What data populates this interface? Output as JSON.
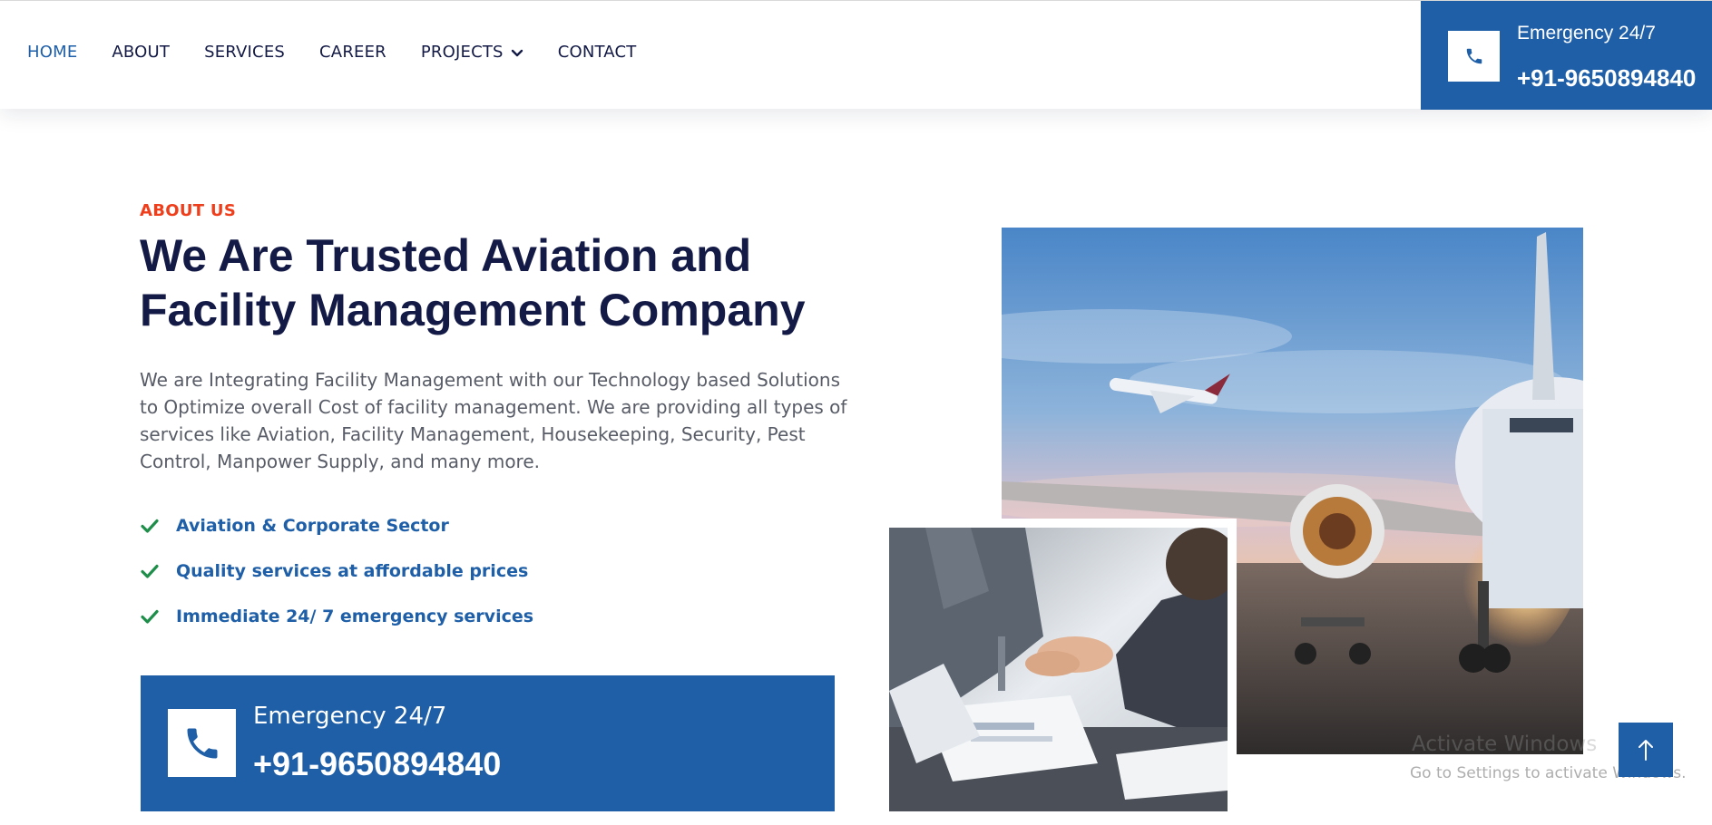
{
  "nav": {
    "items": [
      {
        "label": "HOME",
        "active": true
      },
      {
        "label": "ABOUT"
      },
      {
        "label": "SERVICES"
      },
      {
        "label": "CAREER"
      },
      {
        "label": "PROJECTS",
        "has_dropdown": true
      },
      {
        "label": "CONTACT"
      }
    ]
  },
  "header_emergency": {
    "label": "Emergency 24/7",
    "phone": "+91-9650894840",
    "icon": "phone-icon"
  },
  "about": {
    "tag": "ABOUT US",
    "headline_line1": "We Are Trusted Aviation and",
    "headline_line2": "Facility Management Company",
    "description": "We are Integrating Facility Management with our Technology based Solutions to Optimize overall Cost of facility management. We are providing all types of services like Aviation, Facility Management, Housekeeping, Security, Pest Control, Manpower Supply, and many more.",
    "features": [
      "Aviation & Corporate Sector",
      "Quality services at affordable prices",
      "Immediate 24/ 7 emergency services"
    ]
  },
  "bottom_emergency": {
    "label": "Emergency 24/7",
    "phone": "+91-9650894840",
    "icon": "phone-icon"
  },
  "os_watermark": {
    "title": "Activate Windows",
    "subtitle": "Go to Settings to activate Windows."
  },
  "colors": {
    "brand_blue": "#1f5fa8",
    "navy": "#131a46",
    "accent_red": "#ef3e1c",
    "check_green": "#1e8e4a"
  },
  "scroll_top_icon": "arrow-up-icon"
}
